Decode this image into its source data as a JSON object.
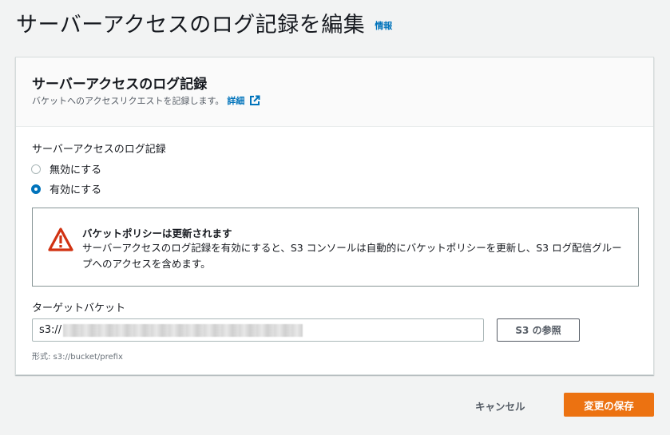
{
  "header": {
    "title": "サーバーアクセスのログ記録を編集",
    "info_link": "情報"
  },
  "panel": {
    "title": "サーバーアクセスのログ記録",
    "description": "バケットへのアクセスリクエストを記録します。",
    "detail_link": "詳細",
    "field_label": "サーバーアクセスのログ記録",
    "options": [
      {
        "label": "無効にする",
        "selected": false
      },
      {
        "label": "有効にする",
        "selected": true
      }
    ],
    "alert": {
      "title": "バケットポリシーは更新されます",
      "body": "サーバーアクセスのログ記録を有効にすると、S3 コンソールは自動的にバケットポリシーを更新し、S3 ログ配信グループへのアクセスを含めます。"
    },
    "target_label": "ターゲットバケット",
    "target_prefix": "s3://",
    "browse_button": "S3 の参照",
    "format_hint": "形式: s3://bucket/prefix"
  },
  "footer": {
    "cancel_label": "キャンセル",
    "save_label": "変更の保存"
  },
  "colors": {
    "primary": "#ec7211",
    "link": "#0073bb",
    "warning": "#d13212"
  },
  "icons": {
    "external_link": "external-link-icon",
    "warning": "warning-icon"
  }
}
